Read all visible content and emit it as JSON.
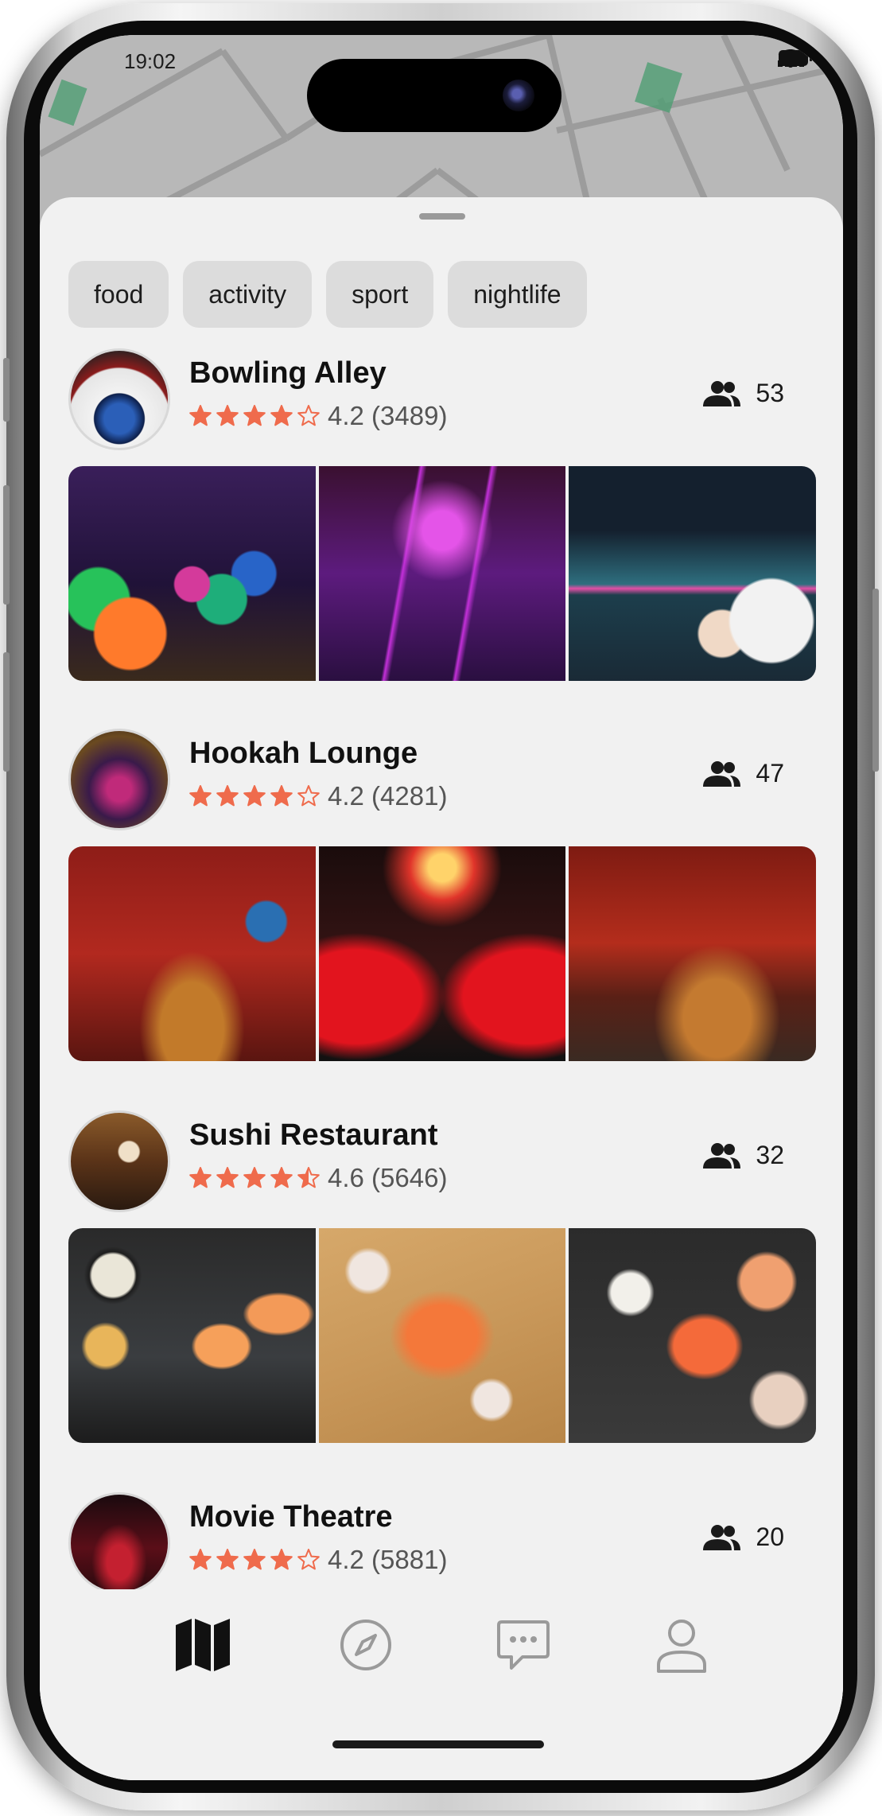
{
  "status_bar": {
    "time": "19:02"
  },
  "filters": [
    "food",
    "activity",
    "sport",
    "nightlife"
  ],
  "colors": {
    "star": "#ef6b4c",
    "chip_bg": "#dcdcdc",
    "sheet_bg": "#f1f1f1"
  },
  "places": [
    {
      "name": "Bowling Alley",
      "rating": 4.2,
      "rating_text": "4.2 (3489)",
      "people": "53"
    },
    {
      "name": "Hookah Lounge",
      "rating": 4.2,
      "rating_text": "4.2 (4281)",
      "people": "47"
    },
    {
      "name": "Sushi Restaurant",
      "rating": 4.6,
      "rating_text": "4.6 (5646)",
      "people": "32"
    },
    {
      "name": "Movie Theatre",
      "rating": 4.2,
      "rating_text": "4.2 (5881)",
      "people": "20"
    }
  ],
  "bottom_nav": {
    "items": [
      {
        "icon": "map-icon",
        "active": true
      },
      {
        "icon": "compass-icon",
        "active": false
      },
      {
        "icon": "chat-icon",
        "active": false
      },
      {
        "icon": "profile-icon",
        "active": false
      }
    ]
  }
}
